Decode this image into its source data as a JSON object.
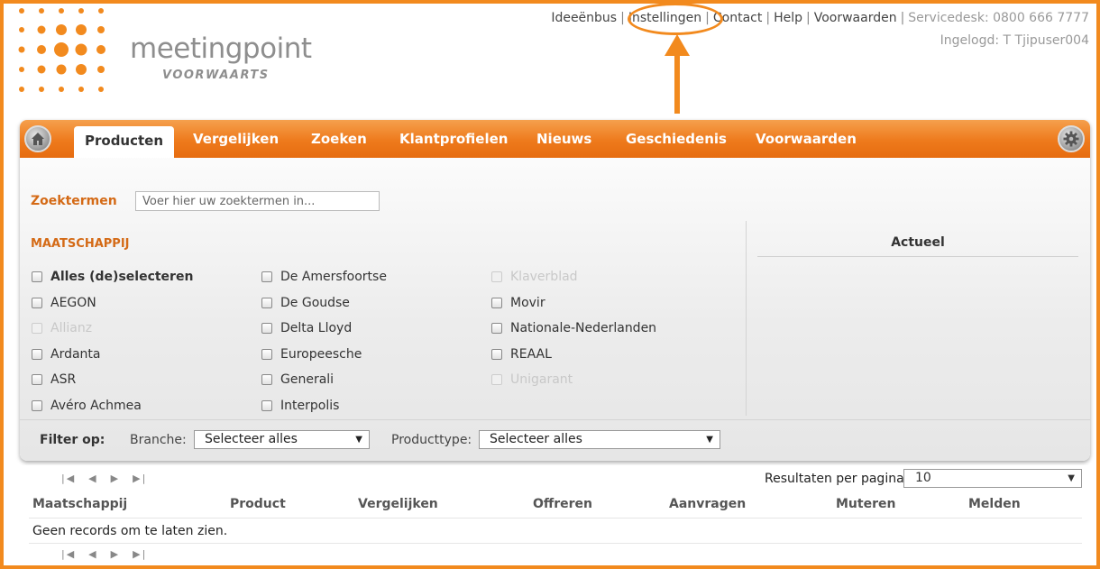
{
  "brand": {
    "name": "meetingpoint",
    "tagline": "VOORWAARTS",
    "accent": "#f28a1e"
  },
  "toplinks": {
    "items": [
      "Ideeënbus",
      "Instellingen",
      "Contact",
      "Help",
      "Voorwaarden"
    ],
    "servicedesk": "Servicedesk: 0800 666 7777",
    "user": "Ingelogd: T Tjipuser004"
  },
  "nav": {
    "home_icon": "home-icon",
    "settings_icon": "gear-icon",
    "tabs": [
      "Producten",
      "Vergelijken",
      "Zoeken",
      "Klantprofielen",
      "Nieuws",
      "Geschiedenis",
      "Voorwaarden"
    ],
    "active_tab": "Producten"
  },
  "search": {
    "label": "Zoektermen",
    "placeholder": "Voer hier uw zoektermen in...",
    "value": ""
  },
  "maatschappij": {
    "title": "MAATSCHAPPIJ",
    "col1": [
      {
        "label": "Alles (de)selecteren",
        "disabled": false,
        "bold": true
      },
      {
        "label": "AEGON",
        "disabled": false
      },
      {
        "label": "Allianz",
        "disabled": true
      },
      {
        "label": "Ardanta",
        "disabled": false
      },
      {
        "label": "ASR",
        "disabled": false
      },
      {
        "label": "Avéro Achmea",
        "disabled": false
      }
    ],
    "col2": [
      {
        "label": "De Amersfoortse",
        "disabled": false
      },
      {
        "label": "De Goudse",
        "disabled": false
      },
      {
        "label": "Delta Lloyd",
        "disabled": false
      },
      {
        "label": "Europeesche",
        "disabled": false
      },
      {
        "label": "Generali",
        "disabled": false
      },
      {
        "label": "Interpolis",
        "disabled": false
      }
    ],
    "col3": [
      {
        "label": "Klaverblad",
        "disabled": true
      },
      {
        "label": "Movir",
        "disabled": false
      },
      {
        "label": "Nationale-Nederlanden",
        "disabled": false
      },
      {
        "label": "REAAL",
        "disabled": false
      },
      {
        "label": "Unigarant",
        "disabled": true
      }
    ]
  },
  "actueel": {
    "title": "Actueel"
  },
  "filter": {
    "label": "Filter op:",
    "branche_label": "Branche:",
    "branche_value": "Selecteer alles",
    "producttype_label": "Producttype:",
    "producttype_value": "Selecteer alles"
  },
  "results": {
    "per_page_label": "Resultaten per pagina:",
    "per_page_value": "10",
    "columns": [
      "Maatschappij",
      "Product",
      "Vergelijken",
      "Offreren",
      "Aanvragen",
      "Muteren",
      "Melden"
    ],
    "empty_text": "Geen records om te laten zien.",
    "pager": [
      "first-page-icon",
      "prev-page-icon",
      "next-page-icon",
      "last-page-icon"
    ]
  }
}
